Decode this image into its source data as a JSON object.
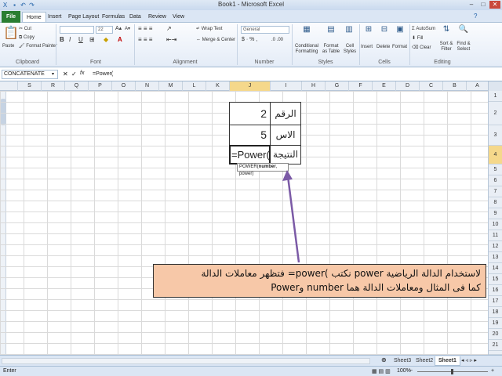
{
  "window": {
    "title": "Book1 - Microsoft Excel"
  },
  "tabs": [
    "File",
    "Home",
    "Insert",
    "Page Layout",
    "Formulas",
    "Data",
    "Review",
    "View"
  ],
  "ribbon": {
    "clipboard": {
      "paste": "Paste",
      "cut": "Cut",
      "copy": "Copy",
      "format_painter": "Format Painter",
      "label": "Clipboard"
    },
    "font": {
      "size": "22",
      "label": "Font"
    },
    "alignment": {
      "wrap": "Wrap Text",
      "merge": "Merge & Center",
      "label": "Alignment"
    },
    "number": {
      "format": "General",
      "label": "Number"
    },
    "styles": {
      "conditional": "Conditional Formatting",
      "format_table": "Format as Table",
      "cell_styles": "Cell Styles",
      "label": "Styles"
    },
    "cells": {
      "insert": "Insert",
      "delete": "Delete",
      "format": "Format",
      "label": "Cells"
    },
    "editing": {
      "autosum": "AutoSum",
      "fill": "Fill",
      "clear": "Clear",
      "sort": "Sort & Filter",
      "find": "Find & Select",
      "label": "Editing"
    }
  },
  "formula_bar": {
    "name_box": "CONCATENATE",
    "formula": "=Power("
  },
  "columns": [
    "S",
    "R",
    "Q",
    "P",
    "O",
    "N",
    "M",
    "L",
    "K",
    "J",
    "I",
    "H",
    "G",
    "F",
    "E",
    "D",
    "C",
    "B",
    "A"
  ],
  "rows": [
    "1",
    "2",
    "3",
    "4",
    "5",
    "6",
    "7",
    "8",
    "9",
    "10",
    "11",
    "12",
    "13",
    "14",
    "15",
    "16",
    "17",
    "18",
    "19",
    "20",
    "21",
    "22",
    "23"
  ],
  "cells": {
    "i2": "الرقم",
    "j2": "2",
    "i3": "الاس",
    "j3": "5",
    "i4": "النتيجة",
    "j4": "=Power("
  },
  "tooltip": {
    "prefix": "POWER(",
    "arg1": "number",
    "rest": ", power)"
  },
  "callout": {
    "line1": "لاستخدام الدالة الرياضية power نكتب )power= فتظهر معاملات الدالة",
    "line2": "كما فى المثال ومعاملات الدالة هما number وPower"
  },
  "sheets": [
    "Sheet3",
    "Sheet2",
    "Sheet1"
  ],
  "status": {
    "mode": "Enter",
    "zoom": "100%"
  },
  "colors": {
    "file_tab": "#2a7e32",
    "callout_fill": "#f7c8a8",
    "arrow": "#7b5aa6",
    "selected_header": "#f5d88b"
  }
}
